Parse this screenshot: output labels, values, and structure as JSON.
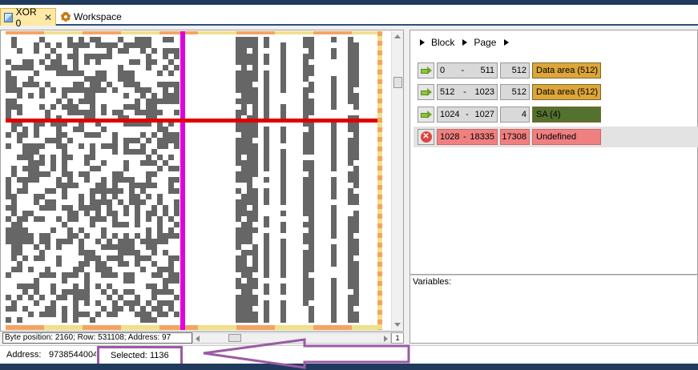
{
  "tabs": [
    {
      "label": "XOR 0",
      "icon": "xor-icon",
      "active": true,
      "closable": true
    },
    {
      "label": "Workspace",
      "icon": "gear-icon",
      "active": false
    }
  ],
  "visualizer": {
    "position_text": "Byte position: 2160; Row: 531108; Address: 97",
    "zoom_value": "1"
  },
  "breadcrumb": [
    "Block",
    "Page"
  ],
  "regions": [
    {
      "icon": "arrow-right-icon",
      "start": "0",
      "end": "511",
      "size": "512",
      "label": "Data area (512)",
      "color": "#dca63a"
    },
    {
      "icon": "arrow-right-icon",
      "start": "512",
      "end": "1023",
      "size": "512",
      "label": "Data area (512)",
      "color": "#dca63a"
    },
    {
      "icon": "arrow-right-icon",
      "start": "1024",
      "end": "1027",
      "size": "4",
      "label": "SA (4)",
      "color": "#55712f"
    },
    {
      "icon": "error-icon",
      "start": "1028",
      "end": "18335",
      "size": "17308",
      "label": "Undefined",
      "color": "#f08080"
    }
  ],
  "range_separator": "-",
  "variables_label": "Variables:",
  "status": {
    "address_label": "Address:",
    "address_value": "9738544004",
    "selected_label": "Selected:",
    "selected_value": "1136"
  },
  "colors": {
    "cell_dark": "#666666",
    "highlight_column": "#e000e0",
    "highlight_row": "#e00000",
    "stripe_orange": "#f4a460",
    "stripe_yellow": "#f0e08c",
    "annotation": "#9b5aa5"
  }
}
